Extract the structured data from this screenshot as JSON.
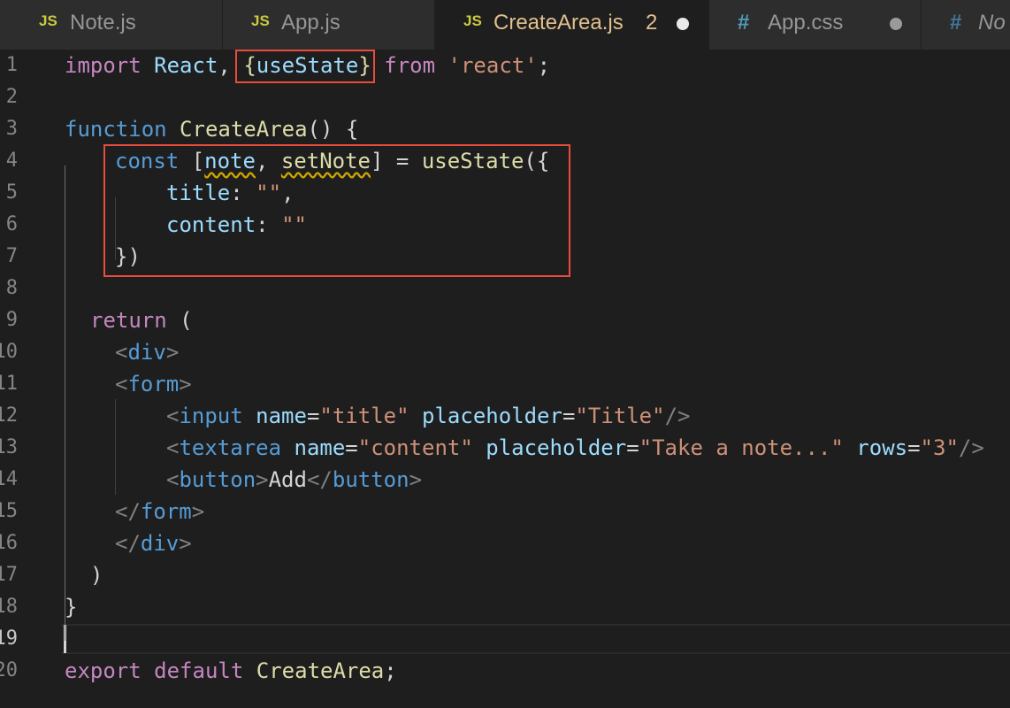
{
  "tabs": [
    {
      "icon": "JS",
      "label": "Note.js",
      "active": false
    },
    {
      "icon": "JS",
      "label": "App.js",
      "active": false
    },
    {
      "icon": "JS",
      "label": "CreateArea.js",
      "problems": "2",
      "active": true,
      "modified": true
    },
    {
      "icon": "#",
      "label": "App.css",
      "active": false,
      "modified": true
    },
    {
      "icon": "#",
      "label": "No",
      "active": false
    }
  ],
  "line_numbers": [
    "1",
    "2",
    "3",
    "4",
    "5",
    "6",
    "7",
    "8",
    "9",
    "10",
    "11",
    "12",
    "13",
    "14",
    "15",
    "16",
    "17",
    "18",
    "19",
    "20"
  ],
  "current_line": "19",
  "code": {
    "l1": {
      "import": "import",
      "react": "React",
      "comma": ",",
      "brace_open": "{",
      "useState": "useState",
      "brace_close": "}",
      "from": "from",
      "module": "'react'",
      "semi": ";"
    },
    "l3": {
      "function": "function",
      "name": "CreateArea",
      "rest": "() {"
    },
    "l4": {
      "const": "const",
      "open": "[",
      "note": "note",
      "comma": ",",
      "setNote": "setNote",
      "close": "]",
      "eq": "=",
      "call": "useState",
      "args": "({"
    },
    "l5": {
      "key": "title",
      "colon": ":",
      "val": "\"\"",
      "comma": ","
    },
    "l6": {
      "key": "content",
      "colon": ":",
      "val": "\"\""
    },
    "l7": {
      "text": "})"
    },
    "l9": {
      "return": "return",
      "paren": "("
    },
    "l10": {
      "lt": "<",
      "tag": "div",
      "gt": ">"
    },
    "l11": {
      "lt": "<",
      "tag": "form",
      "gt": ">"
    },
    "l12": {
      "lt": "<",
      "tag": "input",
      "attr1": "name",
      "eq1": "=",
      "val1": "\"title\"",
      "attr2": "placeholder",
      "eq2": "=",
      "val2": "\"Title\"",
      "end": "/>"
    },
    "l13": {
      "lt": "<",
      "tag": "textarea",
      "attr1": "name",
      "eq1": "=",
      "val1": "\"content\"",
      "attr2": "placeholder",
      "eq2": "=",
      "val2": "\"Take a note...\"",
      "attr3": "rows",
      "eq3": "=",
      "val3": "\"3\"",
      "end": "/>"
    },
    "l14": {
      "lt": "<",
      "tag": "button",
      "gt": ">",
      "text": "Add",
      "close_lt": "</",
      "close_tag": "button",
      "close_gt": ">"
    },
    "l15": {
      "lt": "</",
      "tag": "form",
      "gt": ">"
    },
    "l16": {
      "lt": "</",
      "tag": "div",
      "gt": ">"
    },
    "l17": {
      "text": ")"
    },
    "l18": {
      "text": "}"
    },
    "l20": {
      "export": "export",
      "default": "default",
      "name": "CreateArea",
      "semi": ";"
    }
  },
  "colors": {
    "background": "#1e1e1e",
    "keyword_control": "#c586c0",
    "keyword_storage": "#569cd6",
    "function": "#dcdcaa",
    "variable": "#9cdcfe",
    "class": "#4ec9b0",
    "string": "#ce9178",
    "highlight_box": "#e74c3c",
    "warning_squiggle": "#cca700"
  }
}
